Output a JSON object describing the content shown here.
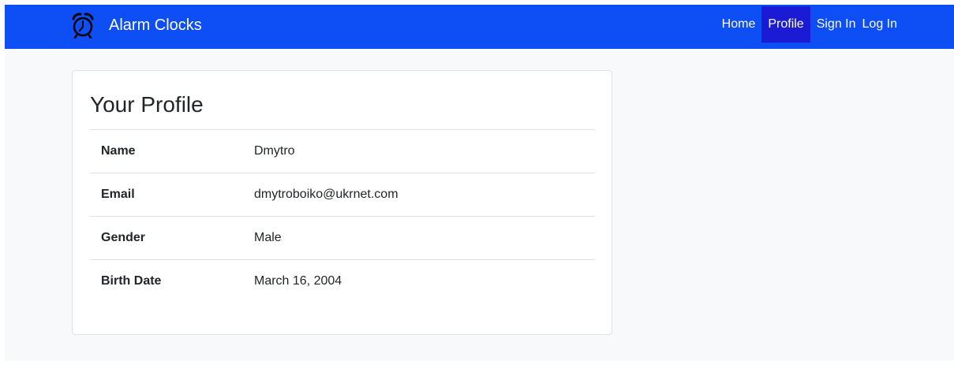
{
  "app": {
    "brand_name": "Alarm Clocks",
    "brand_icon": "alarm-clock-icon"
  },
  "nav": {
    "items": [
      {
        "label": "Home",
        "active": false
      },
      {
        "label": "Profile",
        "active": true
      },
      {
        "label": "Sign In",
        "active": false
      },
      {
        "label": "Log In",
        "active": false
      }
    ]
  },
  "profile": {
    "title": "Your Profile",
    "rows": [
      {
        "label": "Name",
        "value": "Dmytro"
      },
      {
        "label": "Email",
        "value": "dmytroboiko@ukrnet.com"
      },
      {
        "label": "Gender",
        "value": "Male"
      },
      {
        "label": "Birth Date",
        "value": "March 16, 2004"
      }
    ]
  },
  "colors": {
    "navbar": "#0d4ef5",
    "nav_active": "#1c1bd4",
    "page_background": "#f8f9fa"
  }
}
